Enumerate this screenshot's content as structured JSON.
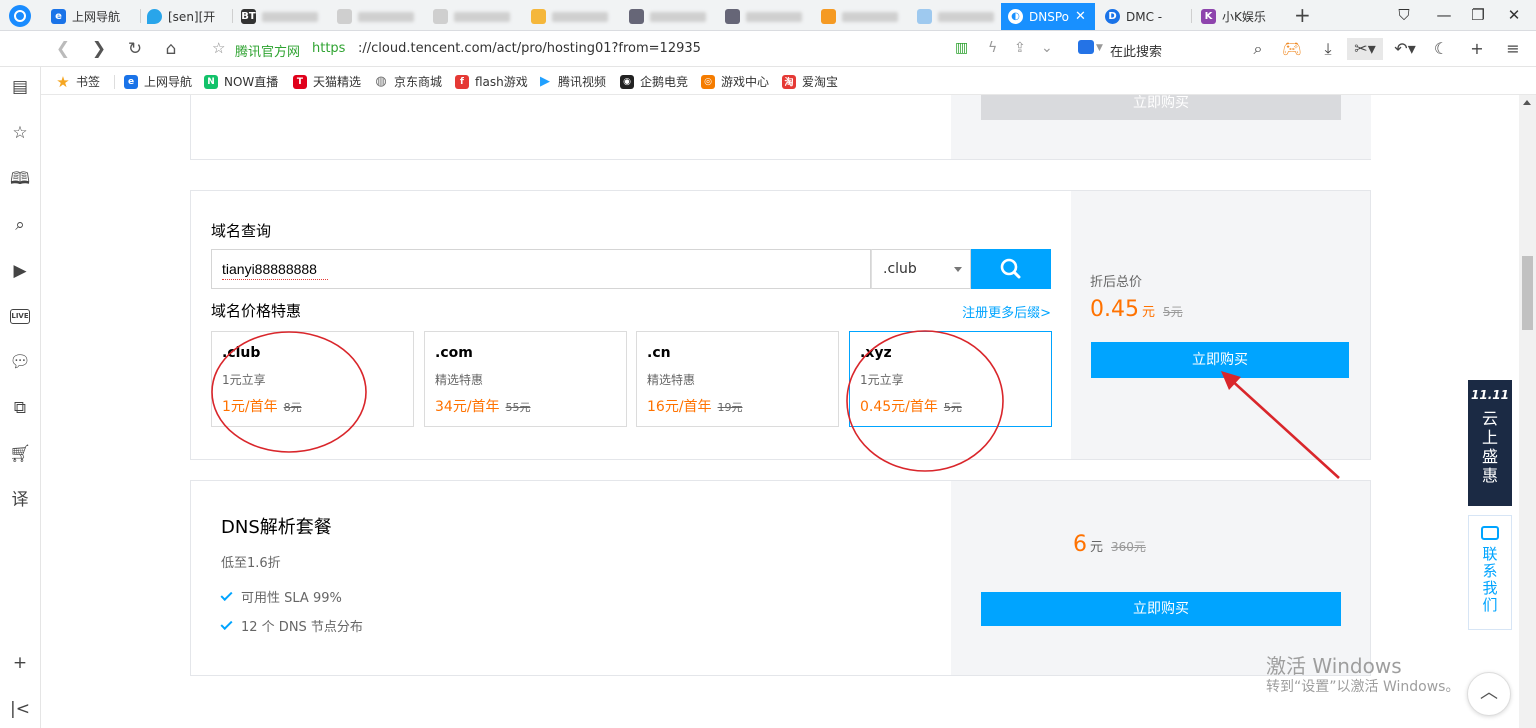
{
  "browser": {
    "tabs": [
      {
        "label": "上网导航",
        "active": false
      },
      {
        "label": "[sen][开",
        "active": false
      },
      {
        "label": "",
        "active": false
      },
      {
        "label": "",
        "active": false
      },
      {
        "label": "",
        "active": false
      },
      {
        "label": "",
        "active": false
      },
      {
        "label": "",
        "active": false
      },
      {
        "label": "",
        "active": false
      },
      {
        "label": "",
        "active": false
      },
      {
        "label": "",
        "active": false
      },
      {
        "label": "DNSPo",
        "active": true
      },
      {
        "label": "DMC - ",
        "active": false
      },
      {
        "label": "小K娱乐",
        "active": false
      }
    ],
    "address": {
      "site_name": "腾讯官方网",
      "url_scheme": "https",
      "url_rest": "://cloud.tencent.com/act/pro/hosting01?from=12935"
    },
    "search_placeholder": "在此搜索",
    "bookmarks": [
      "书签",
      "上网导航",
      "NOW直播",
      "天猫精选",
      "京东商城",
      "flash游戏",
      "腾讯视频",
      "企鹅电竞",
      "游戏中心",
      "爱淘宝"
    ]
  },
  "page": {
    "top_card": {
      "buy_label": "立即购买"
    },
    "domain_card": {
      "title": "域名查询",
      "search_value": "tianyi88888888",
      "tld_selected": ".club",
      "price_title": "域名价格特惠",
      "more_link": "注册更多后缀>",
      "tlds": [
        {
          "name": ".club",
          "desc": "1元立享",
          "price": "1元/首年",
          "orig": "8元",
          "selected": false
        },
        {
          "name": ".com",
          "desc": "精选特惠",
          "price": "34元/首年",
          "orig": "55元",
          "selected": false
        },
        {
          "name": ".cn",
          "desc": "精选特惠",
          "price": "16元/首年",
          "orig": "19元",
          "selected": false
        },
        {
          "name": ".xyz",
          "desc": "1元立享",
          "price": "0.45元/首年",
          "orig": "5元",
          "selected": true
        }
      ],
      "summary": {
        "label": "折后总价",
        "price": "0.45",
        "unit": "元",
        "orig": "5元",
        "buy_label": "立即购买"
      }
    },
    "dns_card": {
      "title": "DNS解析套餐",
      "subtitle": "低至1.6折",
      "features": [
        "可用性 SLA 99%",
        "12 个 DNS 节点分布"
      ],
      "price": "6",
      "unit": "元",
      "orig": "360元",
      "buy_label": "立即购买"
    },
    "float_promo": {
      "line1": "11.11",
      "chars": [
        "云",
        "上",
        "盛",
        "惠"
      ]
    },
    "float_contact": {
      "chars": [
        "联",
        "系",
        "我",
        "们"
      ]
    },
    "watermark": {
      "line1": "激活 Windows",
      "line2": "转到“设置”以激活 Windows。"
    }
  }
}
